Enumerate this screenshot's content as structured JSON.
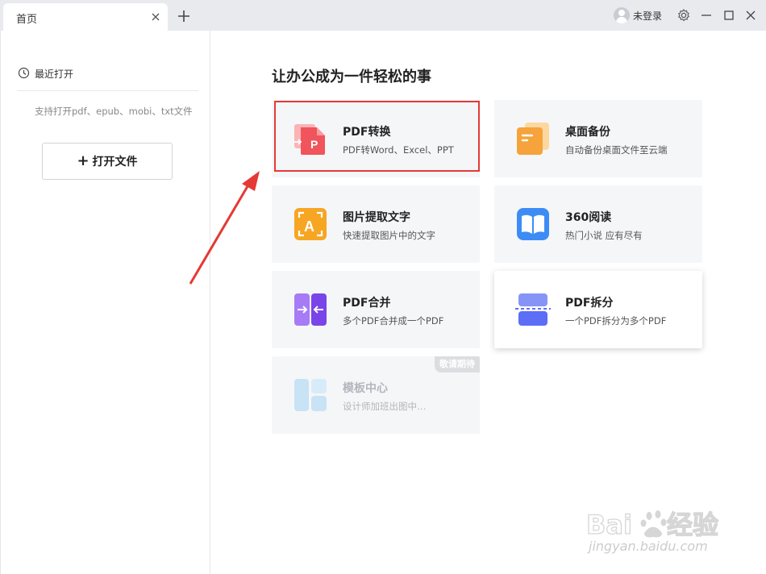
{
  "titlebar": {
    "tab_label": "首页",
    "login_label": "未登录"
  },
  "sidebar": {
    "recent_label": "最近打开",
    "support_text": "支持打开pdf、epub、mobi、txt文件",
    "open_button": {
      "plus": "+",
      "label": "打开文件"
    }
  },
  "main": {
    "heading": "让办公成为一件轻松的事",
    "cards": [
      {
        "title": "PDF转换",
        "desc": "PDF转Word、Excel、PPT",
        "icon": "pdf-convert-icon",
        "color": "#f0545c"
      },
      {
        "title": "桌面备份",
        "desc": "自动备份桌面文件至云端",
        "icon": "desktop-backup-icon",
        "color": "#f5a33a"
      },
      {
        "title": "图片提取文字",
        "desc": "快速提取图片中的文字",
        "icon": "image-ocr-icon",
        "color": "#f6a623"
      },
      {
        "title": "360阅读",
        "desc": "热门小说 应有尽有",
        "icon": "book-reader-icon",
        "color": "#3d8cf5"
      },
      {
        "title": "PDF合并",
        "desc": "多个PDF合并成一个PDF",
        "icon": "pdf-merge-icon",
        "color": "#8b5cf0"
      },
      {
        "title": "PDF拆分",
        "desc": "一个PDF拆分为多个PDF",
        "icon": "pdf-split-icon",
        "color": "#5b6ef5"
      },
      {
        "title": "模板中心",
        "desc": "设计师加班出图中…",
        "icon": "template-center-icon",
        "color": "#c8e2f6",
        "badge": "敬请期待"
      }
    ]
  },
  "watermark": {
    "text": "jingyan.baidu.com"
  }
}
